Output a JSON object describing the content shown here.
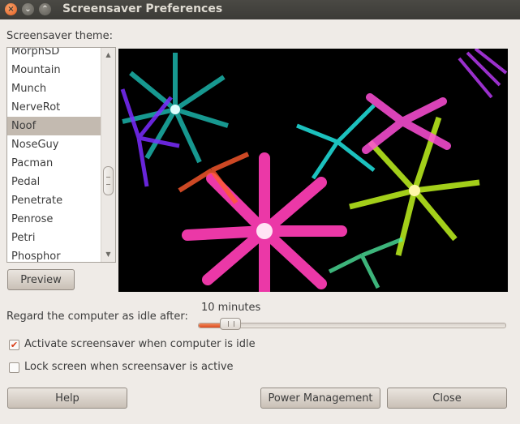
{
  "window": {
    "title": "Screensaver Preferences",
    "controls": {
      "close": "×",
      "minimize": "⌄",
      "maximize": "⌃"
    }
  },
  "theme": {
    "label": "Screensaver theme:",
    "items": [
      "MorphSD",
      "Mountain",
      "Munch",
      "NerveRot",
      "Noof",
      "NoseGuy",
      "Pacman",
      "Pedal",
      "Penetrate",
      "Penrose",
      "Petri",
      "Phosphor"
    ],
    "selected": "Noof",
    "scroll_arrows": {
      "up": "▲",
      "down": "▼"
    }
  },
  "preview_button": "Preview",
  "idle": {
    "label": "Regard the computer as idle after:",
    "value_text": "10 minutes",
    "slider_fraction": 0.105
  },
  "options": {
    "activate": {
      "label": "Activate screensaver when computer is idle",
      "checked": true
    },
    "lock": {
      "label": "Lock screen when screensaver is active",
      "checked": false
    }
  },
  "buttons": {
    "help": "Help",
    "power": "Power Management",
    "close": "Close"
  },
  "colors": {
    "accent": "#dd4a1e",
    "selection": "#c3bab0",
    "titlebar": "#3c3b37"
  }
}
